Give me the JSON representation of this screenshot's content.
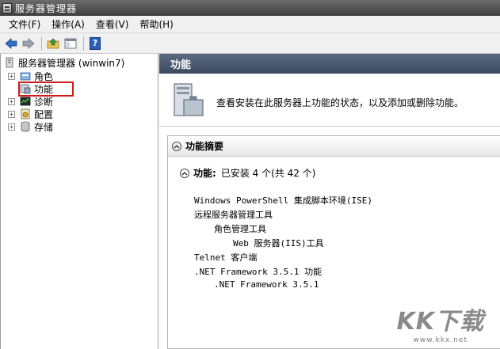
{
  "window": {
    "title": "服务器管理器"
  },
  "menu": [
    {
      "label": "文件(F)"
    },
    {
      "label": "操作(A)"
    },
    {
      "label": "查看(V)"
    },
    {
      "label": "帮助(H)"
    }
  ],
  "toolbar": {
    "back_icon": "back-arrow-icon",
    "forward_icon": "forward-arrow-icon",
    "up_icon": "up-folder-icon",
    "console_icon": "show-hide-console-tree-icon",
    "help_label": "?"
  },
  "tree": {
    "root": "服务器管理器 (winwin7)",
    "items": [
      {
        "label": "角色",
        "expander": "+",
        "icon": "roles-icon"
      },
      {
        "label": "功能",
        "expander": "",
        "icon": "features-icon"
      },
      {
        "label": "诊断",
        "expander": "+",
        "icon": "diagnostics-icon"
      },
      {
        "label": "配置",
        "expander": "+",
        "icon": "configuration-icon"
      },
      {
        "label": "存储",
        "expander": "+",
        "icon": "storage-icon"
      }
    ]
  },
  "content": {
    "header": "功能",
    "description": "查看安装在此服务器上功能的状态，以及添加或删除功能。",
    "section_title": "功能摘要",
    "summary_label": "功能:",
    "summary_value": "已安装 4 个(共 42 个)",
    "features": [
      {
        "text": "Windows PowerShell 集成脚本环境(ISE)"
      },
      {
        "text": "远程服务器管理工具"
      },
      {
        "text": "角色管理工具"
      },
      {
        "text": "Web 服务器(IIS)工具"
      },
      {
        "text": "Telnet 客户端"
      },
      {
        "text": ".NET Framework 3.5.1 功能"
      },
      {
        "text": ".NET Framework 3.5.1"
      }
    ]
  },
  "watermark": {
    "logo": "KK下载",
    "url": "www.kkx.net"
  },
  "colors": {
    "titlebar": "#4a4a4a",
    "content_header": "#4a5870",
    "highlight": "#d01a1a"
  }
}
